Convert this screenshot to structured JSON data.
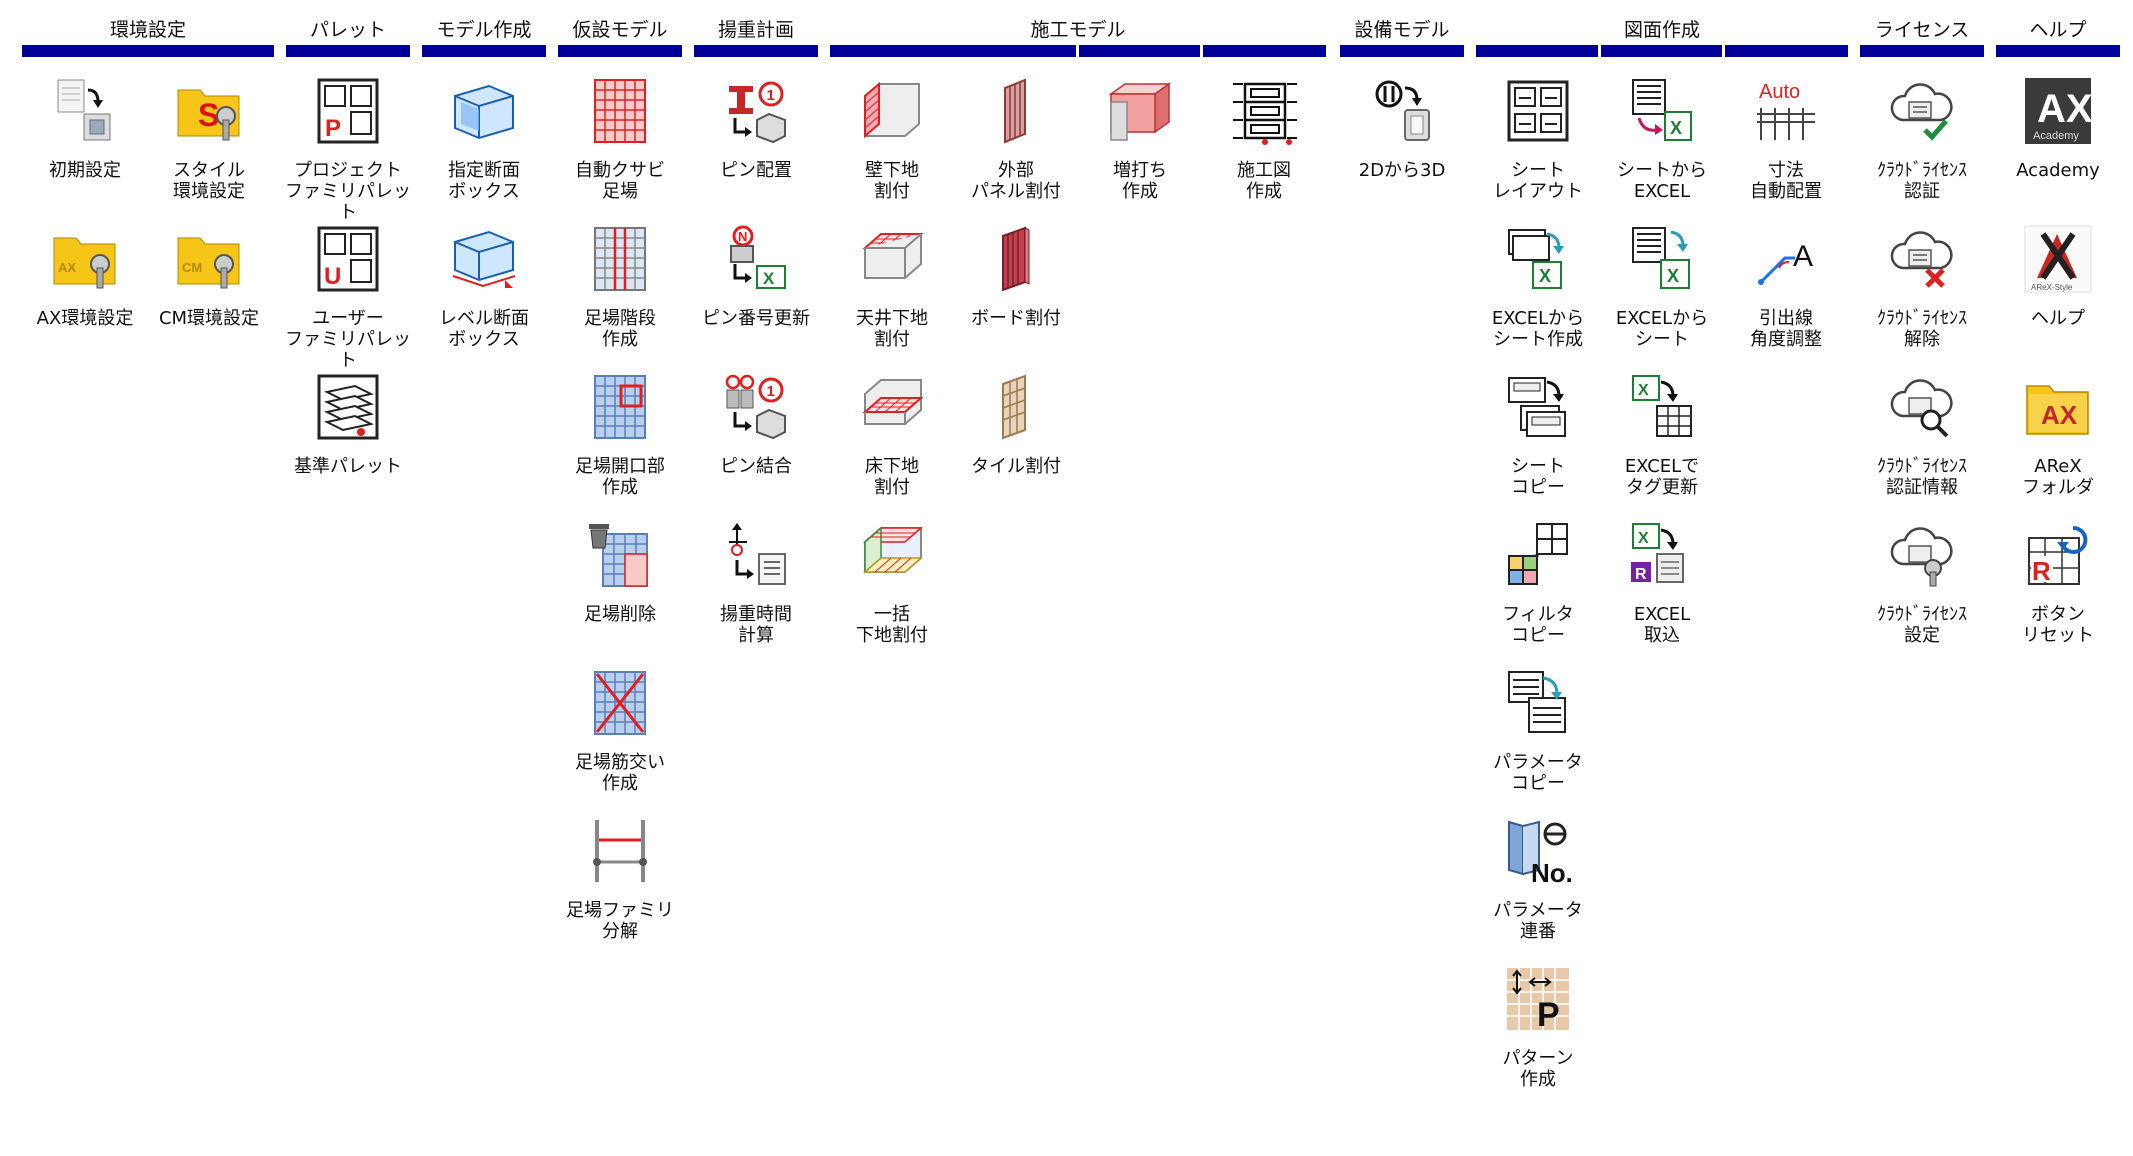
{
  "categories": [
    {
      "id": "env",
      "label": "環境設定",
      "tools": [
        {
          "label": "初期設定",
          "icon": "initial-settings-icon"
        },
        {
          "label": "スタイル\n環境設定",
          "icon": "style-settings-icon"
        },
        {
          "label": "AX環境設定",
          "icon": "ax-settings-folder-icon"
        },
        {
          "label": "CM環境設定",
          "icon": "cm-settings-folder-icon"
        }
      ]
    },
    {
      "id": "palette",
      "label": "パレット",
      "tools": [
        {
          "label": "プロジェクト\nファミリパレット",
          "icon": "project-family-palette-icon"
        },
        {
          "label": "ユーザー\nファミリパレット",
          "icon": "user-family-palette-icon"
        },
        {
          "label": "基準パレット",
          "icon": "level-palette-icon"
        }
      ]
    },
    {
      "id": "model",
      "label": "モデル作成",
      "tools": [
        {
          "label": "指定断面\nボックス",
          "icon": "section-box-icon"
        },
        {
          "label": "レベル断面\nボックス",
          "icon": "level-section-box-icon"
        }
      ]
    },
    {
      "id": "temp",
      "label": "仮設モデル",
      "tools": [
        {
          "label": "自動クサビ\n足場",
          "icon": "auto-scaffold-icon"
        },
        {
          "label": "足場階段\n作成",
          "icon": "scaffold-stairs-icon"
        },
        {
          "label": "足場開口部\n作成",
          "icon": "scaffold-opening-icon"
        },
        {
          "label": "足場削除",
          "icon": "scaffold-delete-icon"
        },
        {
          "label": "足場筋交い\n作成",
          "icon": "scaffold-brace-icon"
        },
        {
          "label": "足場ファミリ\n分解",
          "icon": "scaffold-explode-icon"
        }
      ]
    },
    {
      "id": "lift",
      "label": "揚重計画",
      "tools": [
        {
          "label": "ピン配置",
          "icon": "pin-place-icon"
        },
        {
          "label": "ピン番号更新",
          "icon": "pin-number-update-icon"
        },
        {
          "label": "ピン結合",
          "icon": "pin-merge-icon"
        },
        {
          "label": "揚重時間\n計算",
          "icon": "lift-time-icon"
        }
      ]
    },
    {
      "id": "construct",
      "label": "施工モデル",
      "tools": [
        {
          "label": "壁下地\n割付",
          "icon": "wall-base-icon"
        },
        {
          "label": "外部\nパネル割付",
          "icon": "ext-panel-icon"
        },
        {
          "label": "増打ち\n作成",
          "icon": "extra-concrete-icon"
        },
        {
          "label": "施工図\n作成",
          "icon": "construction-drawing-icon"
        },
        {
          "label": "天井下地\n割付",
          "icon": "ceiling-base-icon"
        },
        {
          "label": "ボード割付",
          "icon": "board-layout-icon"
        },
        {
          "label": "床下地\n割付",
          "icon": "floor-base-icon"
        },
        {
          "label": "タイル割付",
          "icon": "tile-layout-icon"
        },
        {
          "label": "一括\n下地割付",
          "icon": "bulk-base-icon"
        }
      ]
    },
    {
      "id": "equip",
      "label": "設備モデル",
      "tools": [
        {
          "label": "2Dから3D",
          "icon": "2d-to-3d-icon"
        }
      ]
    },
    {
      "id": "drawing",
      "label": "図面作成",
      "tools": [
        {
          "label": "シート\nレイアウト",
          "icon": "sheet-layout-icon"
        },
        {
          "label": "シートから\nEXCEL",
          "icon": "sheet-to-excel-icon"
        },
        {
          "label": "寸法\n自動配置",
          "icon": "auto-dimension-icon"
        },
        {
          "label": "EXCELから\nシート作成",
          "icon": "excel-create-sheet-icon"
        },
        {
          "label": "EXCELから\nシート",
          "icon": "excel-to-sheet-icon"
        },
        {
          "label": "引出線\n角度調整",
          "icon": "leader-angle-icon"
        },
        {
          "label": "シート\nコピー",
          "icon": "sheet-copy-icon"
        },
        {
          "label": "EXCELで\nタグ更新",
          "icon": "excel-tag-update-icon"
        },
        {
          "label": "フィルタ\nコピー",
          "icon": "filter-copy-icon"
        },
        {
          "label": "EXCEL\n取込",
          "icon": "excel-import-icon"
        },
        {
          "label": "パラメータ\nコピー",
          "icon": "parameter-copy-icon"
        },
        {
          "label": "パラメータ\n連番",
          "icon": "parameter-numbering-icon"
        },
        {
          "label": "パターン\n作成",
          "icon": "pattern-create-icon"
        }
      ]
    },
    {
      "id": "license",
      "label": "ライセンス",
      "tools": [
        {
          "label": "ｸﾗｳﾄﾞﾗｲｾﾝｽ\n認証",
          "icon": "cloud-license-auth-icon"
        },
        {
          "label": "ｸﾗｳﾄﾞﾗｲｾﾝｽ\n解除",
          "icon": "cloud-license-release-icon"
        },
        {
          "label": "ｸﾗｳﾄﾞﾗｲｾﾝｽ\n認証情報",
          "icon": "cloud-license-info-icon"
        },
        {
          "label": "ｸﾗｳﾄﾞﾗｲｾﾝｽ\n設定",
          "icon": "cloud-license-settings-icon"
        }
      ]
    },
    {
      "id": "help",
      "label": "ヘルプ",
      "tools": [
        {
          "label": "Academy",
          "icon": "academy-logo-icon"
        },
        {
          "label": "ヘルプ",
          "icon": "help-logo-icon"
        },
        {
          "label": "AReX\nフォルダ",
          "icon": "arex-folder-icon"
        },
        {
          "label": "ボタン\nリセット",
          "icon": "button-reset-icon"
        }
      ]
    }
  ],
  "icon_text": {
    "project_letter": "P",
    "user_letter": "U",
    "pin_num": "1",
    "pin_n": "N",
    "auto": "Auto",
    "leader_a": "A",
    "no_text": "No.",
    "pattern_p": "P",
    "ax": "AX",
    "academy_sub": "Academy",
    "arex_style": "AReX-Style",
    "reset_r": "R",
    "excel_x": "X",
    "style_s": "S",
    "ax_folder": "AX",
    "cm_folder": "CM",
    "excel_r": "R"
  },
  "colors": {
    "bar": "#000099",
    "excel_green": "#1e7e34",
    "red": "#e02020",
    "scaffold_blue": "#7fa6d8",
    "folder_yellow": "#f5c518"
  }
}
